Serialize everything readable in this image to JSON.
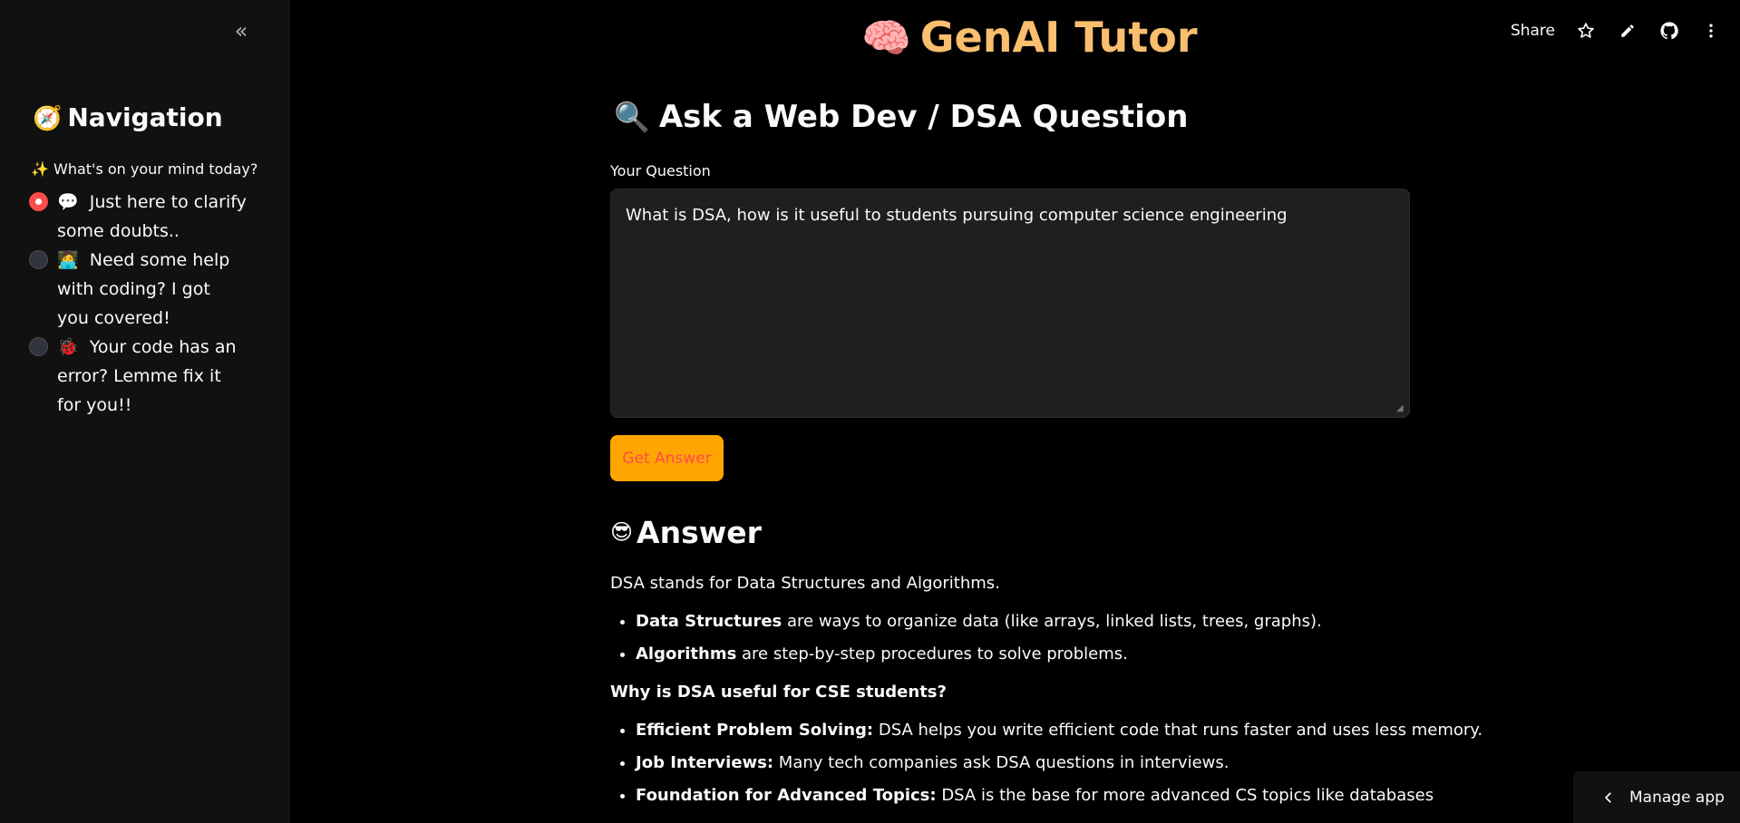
{
  "app": {
    "title": "GenAI Tutor",
    "title_emoji": "🧠",
    "title_color": "#f9be6e"
  },
  "toolbar": {
    "share_label": "Share",
    "icons": [
      "star-icon",
      "edit-icon",
      "github-icon",
      "more-vert-icon"
    ]
  },
  "sidebar": {
    "collapse_icon": "«",
    "title_emoji": "🧭",
    "title": "Navigation",
    "radio_label": "✨ What's on your mind today?",
    "options": [
      {
        "emoji": "💬",
        "label": "Just here to clarify some doubts..",
        "selected": true
      },
      {
        "emoji": "🧑‍💻",
        "label": "Need some help with coding? I got you covered!",
        "selected": false
      },
      {
        "emoji": "🐞",
        "label": "Your code has an error? Lemme fix it for you!!",
        "selected": false
      }
    ]
  },
  "main": {
    "question_heading_emoji": "🔍",
    "question_heading": "Ask a Web Dev / DSA Question",
    "field_label": "Your Question",
    "question_value": "What is DSA, how is it useful to students pursuing computer science engineering",
    "button_label": "Get Answer",
    "answer_heading_emoji": "😎",
    "answer_heading": "Answer",
    "answer": {
      "intro": "DSA stands for Data Structures and Algorithms.",
      "definitions": [
        {
          "term": "Data Structures",
          "text": " are ways to organize data (like arrays, linked lists, trees, graphs)."
        },
        {
          "term": "Algorithms",
          "text": " are step-by-step procedures to solve problems."
        }
      ],
      "why_heading": "Why is DSA useful for CSE students?",
      "reasons": [
        {
          "term": "Efficient Problem Solving:",
          "text": " DSA helps you write efficient code that runs faster and uses less memory."
        },
        {
          "term": "Job Interviews:",
          "text": " Many tech companies ask DSA questions in interviews."
        },
        {
          "term": "Foundation for Advanced Topics:",
          "text": " DSA is the base for more advanced CS topics like databases"
        }
      ]
    }
  },
  "manage_app": {
    "label": "Manage app"
  },
  "colors": {
    "background": "#000000",
    "sidebar": "#111111",
    "accent_red": "#ff4b4b",
    "button_bg": "#ffa500",
    "input_bg": "#1f1f1f"
  }
}
